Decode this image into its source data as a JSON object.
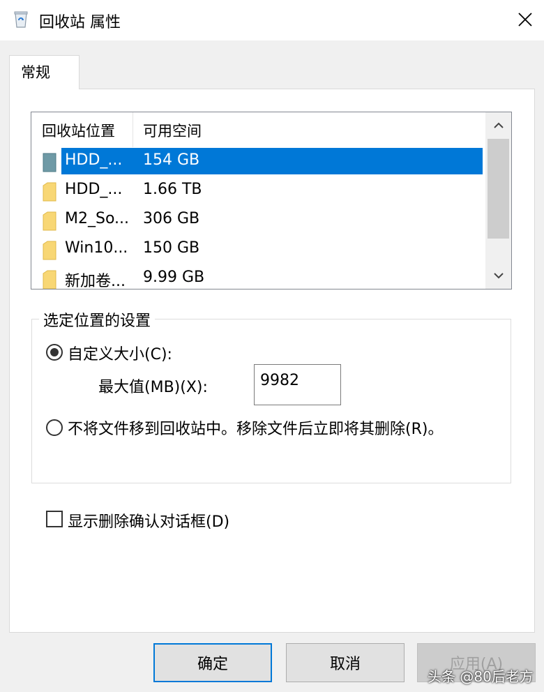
{
  "window": {
    "title": "回收站 属性",
    "icon": "recycle-bin-icon",
    "close_icon": "close-icon"
  },
  "tabs": [
    {
      "label": "常规",
      "selected": true
    }
  ],
  "listview": {
    "columns": [
      "回收站位置",
      "可用空间"
    ],
    "rows": [
      {
        "name": "HDD_...",
        "free": "154 GB",
        "selected": true,
        "icon": "drive-icon"
      },
      {
        "name": "HDD_...",
        "free": "1.66 TB",
        "selected": false,
        "icon": "folder-icon"
      },
      {
        "name": "M2_So...",
        "free": "306 GB",
        "selected": false,
        "icon": "folder-icon"
      },
      {
        "name": "Win10...",
        "free": "150 GB",
        "selected": false,
        "icon": "folder-icon"
      },
      {
        "name": "新加卷...",
        "free": "9.99 GB",
        "selected": false,
        "icon": "folder-icon"
      }
    ]
  },
  "settings": {
    "group_title": "选定位置的设置",
    "custom_size_label": "自定义大小(C):",
    "custom_size_checked": true,
    "max_value_label": "最大值(MB)(X):",
    "max_value": "9982",
    "no_move_label": "不将文件移到回收站中。移除文件后立即将其删除(R)。",
    "no_move_checked": false
  },
  "confirm_dialog": {
    "label": "显示删除确认对话框(D)",
    "checked": false
  },
  "buttons": {
    "ok": "确定",
    "cancel": "取消",
    "apply": "应用(A)"
  },
  "watermark": "头条 @80后老方",
  "colors": {
    "selection": "#0078d7",
    "face": "#f0f0f0"
  }
}
